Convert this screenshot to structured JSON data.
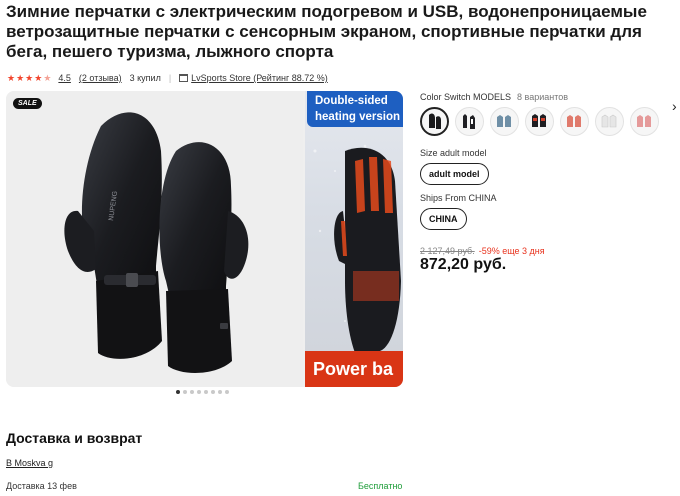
{
  "product": {
    "title": "Зимние перчатки с электрическим подогревом и USB, водонепроницаемые ветрозащитные перчатки с сенсорным экраном, спортивные перчатки для бега, пешего туризма, лыжного спорта"
  },
  "rating": {
    "value": "4.5",
    "stars_filled": 4.5,
    "reviews_label": "(2 отзыва)",
    "bought_label": "3 купил",
    "store_label": "LvSports Store (Рейтинг 88.72 %)"
  },
  "gallery": {
    "sale_badge": "SALE",
    "brand_text": "NUPENG",
    "side_banner_top_line1": "Double-sided",
    "side_banner_top_line2": "heating version",
    "side_banner_bottom": "Power ba",
    "dot_count": 8,
    "active_dot": 0
  },
  "options": {
    "color": {
      "label": "Color Switch MODELS",
      "variants_label": "8 вариантов",
      "swatch_icons": [
        "black-mitten-icon",
        "black-glove-icon",
        "blue-glove-icon",
        "black-red-glove-icon",
        "red-glove-icon",
        "white-glove-icon",
        "pink-glove-icon"
      ],
      "selected_index": 0
    },
    "size": {
      "label": "Size adult model",
      "value": "adult model"
    },
    "ships_from": {
      "label": "Ships From CHINA",
      "value": "CHINA"
    }
  },
  "pricing": {
    "old_price": "2 127,49 руб.",
    "discount_label": "-59% еще 3 дня",
    "price": "872,20 руб."
  },
  "delivery": {
    "heading": "Доставка и возврат",
    "city": "В Moskva g",
    "date_label": "Доставка 13 фев",
    "cost_label": "Бесплатно"
  },
  "colors": {
    "accent_red": "#e8331e",
    "free_green": "#1f9d3a",
    "banner_blue": "#1e5fc1",
    "banner_red": "#d93515"
  }
}
